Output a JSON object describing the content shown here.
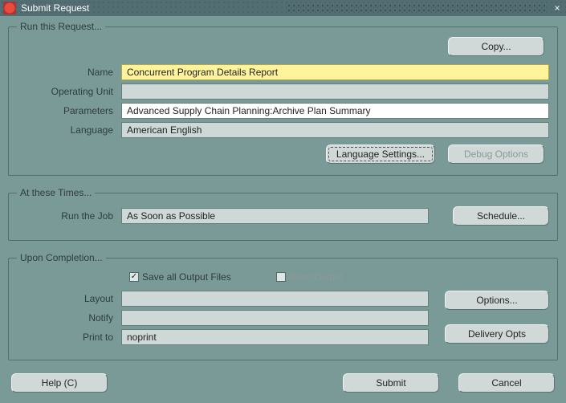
{
  "window": {
    "title": "Submit Request",
    "close_symbol": "×"
  },
  "sections": {
    "run": {
      "legend": "Run this Request...",
      "copy_btn": "Copy...",
      "name_label": "Name",
      "name_value": "Concurrent Program Details Report",
      "operating_unit_label": "Operating Unit",
      "operating_unit_value": "",
      "parameters_label": "Parameters",
      "parameters_value": "Advanced Supply Chain Planning:Archive Plan Summary",
      "language_label": "Language",
      "language_value": "American English",
      "lang_settings_btn": "Language Settings...",
      "debug_btn": "Debug Options"
    },
    "times": {
      "legend": "At these Times...",
      "run_job_label": "Run the Job",
      "run_job_value": "As Soon as Possible",
      "schedule_btn": "Schedule..."
    },
    "completion": {
      "legend": "Upon Completion...",
      "save_output_label": "Save all Output Files",
      "burst_label": "Burst Output",
      "layout_label": "Layout",
      "layout_value": "",
      "notify_label": "Notify",
      "notify_value": "",
      "print_to_label": "Print to",
      "print_to_value": "noprint",
      "options_btn": "Options...",
      "delivery_btn": "Delivery Opts"
    }
  },
  "footer": {
    "help_btn": "Help (C)",
    "submit_btn": "Submit",
    "cancel_btn": "Cancel"
  }
}
